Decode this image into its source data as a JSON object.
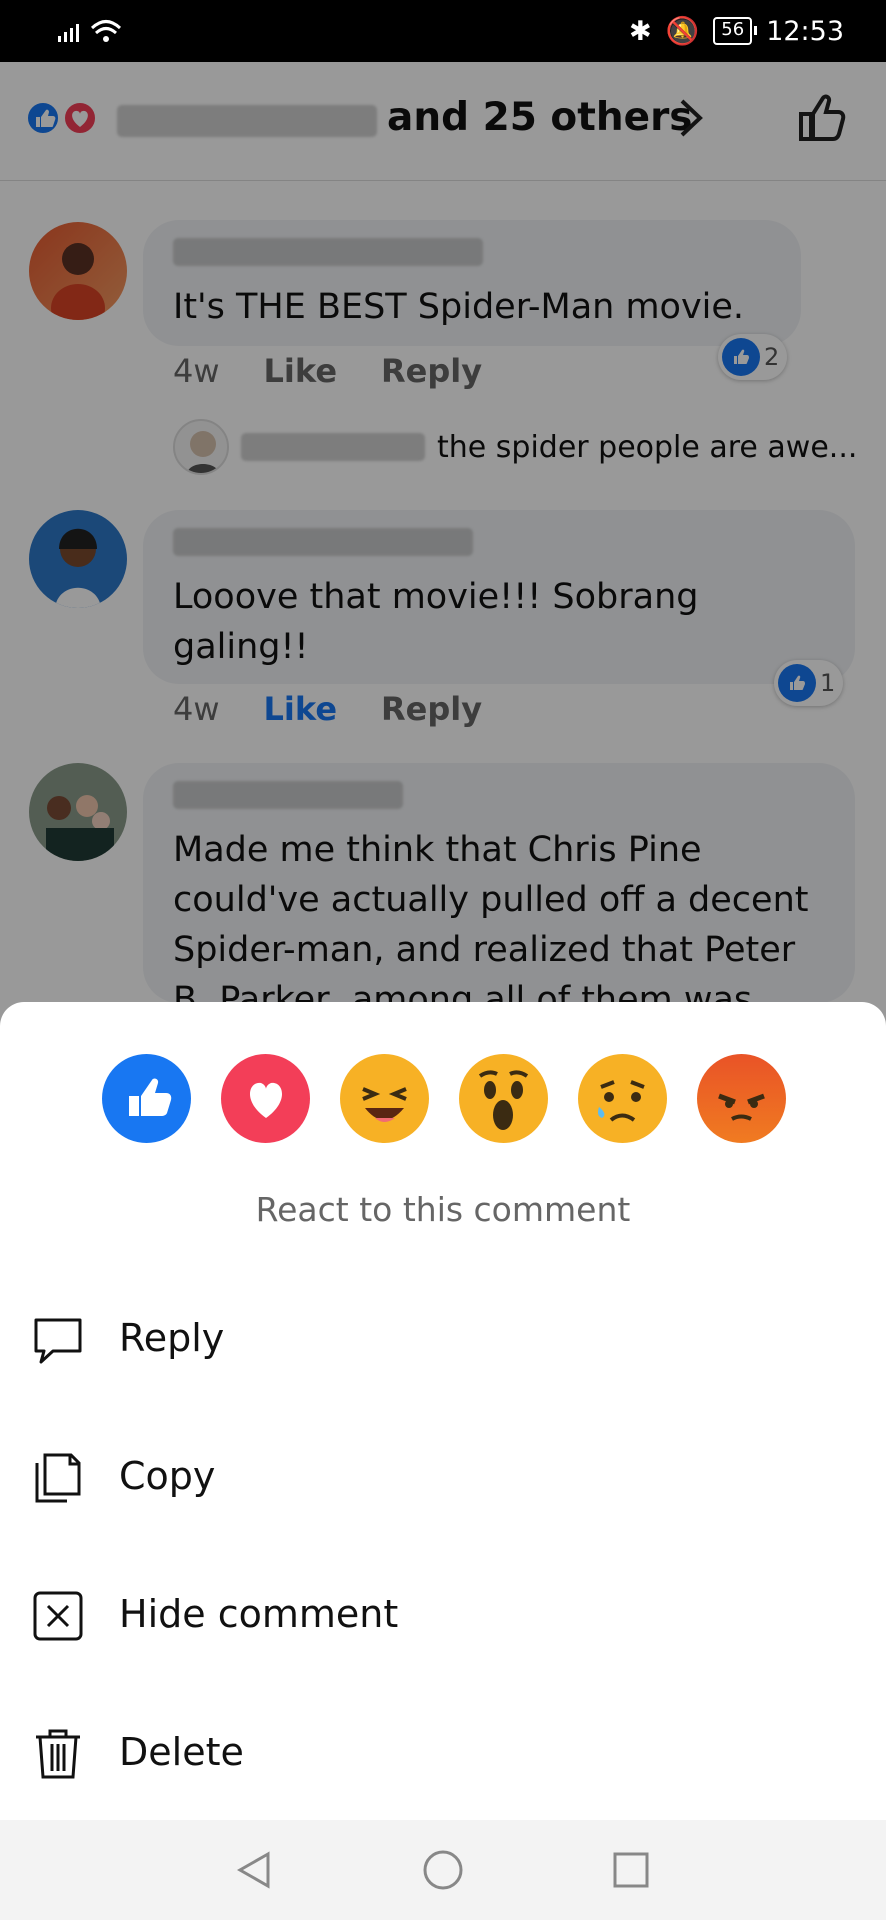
{
  "status_bar": {
    "time": "12:53",
    "battery": "56"
  },
  "header": {
    "others_text": "and 25 others",
    "reaction_icons": [
      "like-reaction-icon",
      "love-reaction-icon"
    ]
  },
  "comments": [
    {
      "text": "It's THE BEST Spider-Man movie.",
      "time": "4w",
      "like_label": "Like",
      "reply_label": "Reply",
      "reaction_count": "2"
    },
    {
      "reply_preview": "the spider people are awe..."
    },
    {
      "text": "Looove that movie!!! Sobrang galing!!",
      "time": "4w",
      "like_label": "Like",
      "reply_label": "Reply",
      "reaction_count": "1"
    },
    {
      "text": "Made me think that Chris Pine could've actually pulled off a decent Spider-man, and realized that Peter B. Parker, among all of them was"
    }
  ],
  "sheet": {
    "prompt": "React to this comment",
    "reactions": [
      "like",
      "love",
      "haha",
      "wow",
      "sad",
      "angry"
    ],
    "menu": [
      {
        "label": "Reply",
        "icon": "speech-bubble-icon"
      },
      {
        "label": "Copy",
        "icon": "copy-icon"
      },
      {
        "label": "Hide comment",
        "icon": "hide-box-icon"
      },
      {
        "label": "Delete",
        "icon": "trash-icon"
      }
    ]
  },
  "colors": {
    "facebook_blue": "#1877f2",
    "love_red": "#f33e58",
    "wow_yellow": "#f7b125",
    "angry_orange": "#e9710f"
  }
}
